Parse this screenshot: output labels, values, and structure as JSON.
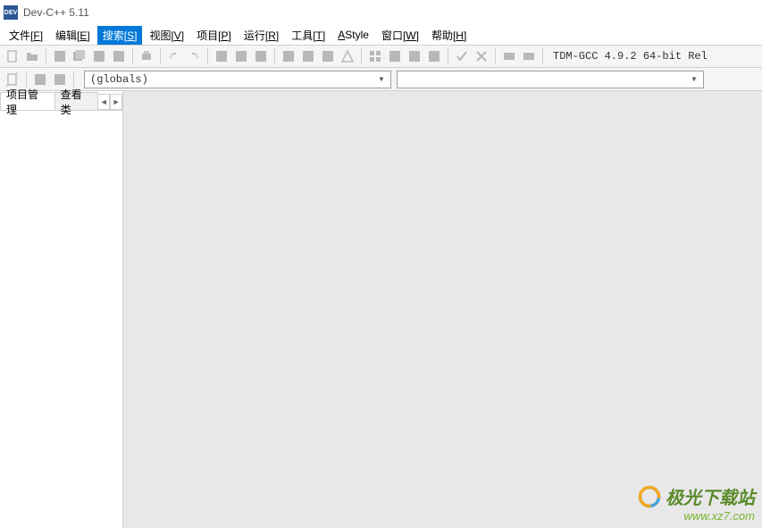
{
  "title": "Dev-C++ 5.11",
  "menubar": [
    {
      "label": "文件",
      "key": "F",
      "active": false
    },
    {
      "label": "编辑",
      "key": "E",
      "active": false
    },
    {
      "label": "搜索",
      "key": "S",
      "active": true
    },
    {
      "label": "视图",
      "key": "V",
      "active": false
    },
    {
      "label": "项目",
      "key": "P",
      "active": false
    },
    {
      "label": "运行",
      "key": "R",
      "active": false
    },
    {
      "label": "工具",
      "key": "T",
      "active": false
    },
    {
      "label": "AStyle",
      "key": "",
      "active": false
    },
    {
      "label": "窗口",
      "key": "W",
      "active": false
    },
    {
      "label": "帮助",
      "key": "H",
      "active": false
    }
  ],
  "compiler_text": "TDM-GCC 4.9.2 64-bit Rel",
  "globals_combo": "(globals)",
  "empty_combo": "",
  "tabs": {
    "left_active": "项目管理",
    "left_inactive": "查看类"
  },
  "watermark": {
    "title": "极光下载站",
    "url": "www.xz7.com"
  }
}
